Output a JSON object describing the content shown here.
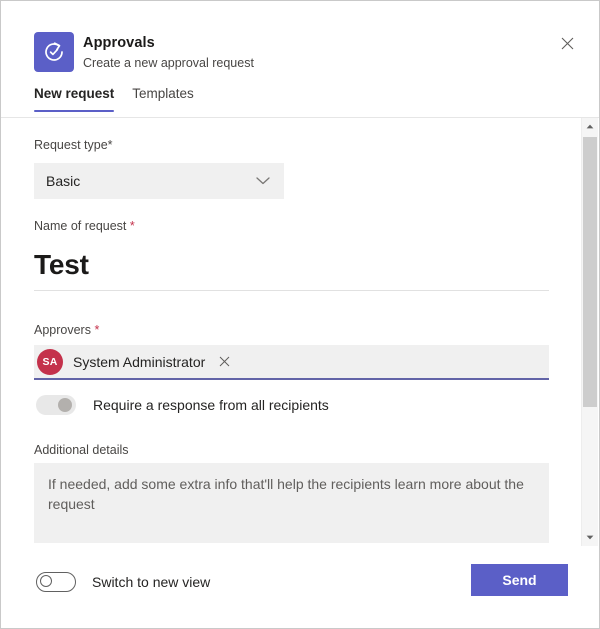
{
  "window": {
    "close_label": "close-icon"
  },
  "header": {
    "app_name": "Approvals",
    "subtitle": "Create a new approval request",
    "icon": "approvals-clock-check-icon",
    "icon_bg": "#5b5fc7"
  },
  "tabs": [
    {
      "label": "New request",
      "active": true
    },
    {
      "label": "Templates",
      "active": false
    }
  ],
  "form": {
    "request_type": {
      "label": "Request type",
      "required_marker": "*",
      "required_color": "#484644",
      "value": "Basic",
      "chevron": "chevron-down-icon"
    },
    "name_of_request": {
      "label": "Name of request",
      "required_marker": "*",
      "required_color": "#c4314b",
      "value": "Test"
    },
    "approvers": {
      "label": "Approvers",
      "required_marker": "*",
      "required_color": "#c4314b",
      "focus_color": "#6264a7",
      "chips": [
        {
          "initials": "SA",
          "name": "System Administrator",
          "avatar_color": "#c4314b",
          "remove_label": "remove-approver-icon"
        }
      ]
    },
    "require_response": {
      "label": "Require a response from all recipients",
      "state": "off"
    },
    "additional_details": {
      "label": "Additional details",
      "value": "",
      "placeholder": "If needed, add some extra info that'll help the recipients learn more about the request"
    }
  },
  "footer": {
    "switch_view": {
      "label": "Switch to new view",
      "state": "off"
    },
    "send_label": "Send",
    "send_color": "#5b5fc7"
  },
  "scrollbar": {
    "up_label": "scroll-up-icon",
    "down_label": "scroll-down-icon"
  }
}
